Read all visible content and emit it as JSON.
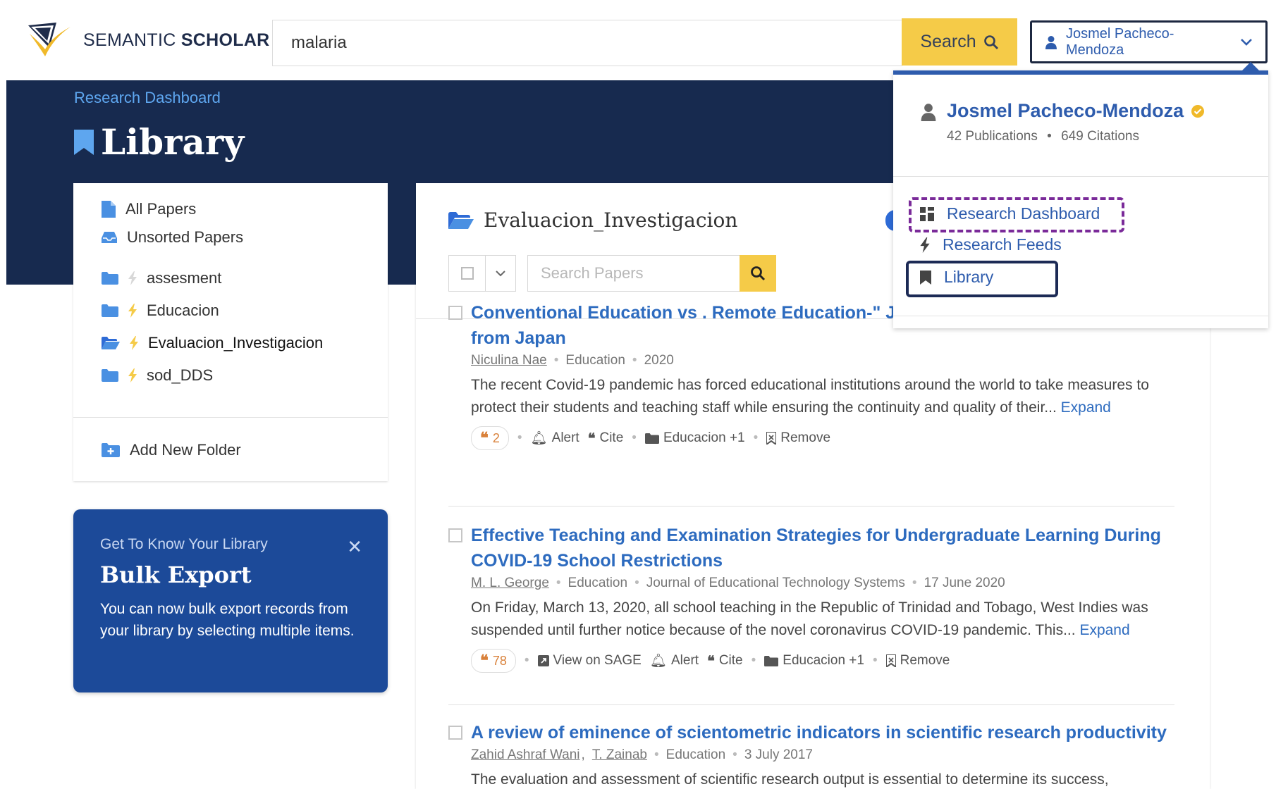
{
  "header": {
    "logo_text_light": "SEMANTIC",
    "logo_text_bold": "SCHOLAR",
    "search_value": "malaria",
    "search_button": "Search",
    "user_button": "Josmel Pacheco-Mendoza"
  },
  "hero": {
    "breadcrumb": "Research Dashboard",
    "title": "Library"
  },
  "sidebar": {
    "items": [
      {
        "label": "All Papers",
        "icon": "document-icon"
      },
      {
        "label": "Unsorted Papers",
        "icon": "inbox-icon"
      }
    ],
    "folders": [
      {
        "label": "assesment",
        "feed": false
      },
      {
        "label": "Educacion",
        "feed": true
      },
      {
        "label": "Evaluacion_Investigacion",
        "feed": true,
        "active": true
      },
      {
        "label": "sod_DDS",
        "feed": true
      }
    ],
    "add_folder": "Add New Folder"
  },
  "promo": {
    "kicker": "Get To Know Your Library",
    "title": "Bulk Export",
    "text": "You can now bulk export records from your library by selecting multiple items."
  },
  "main": {
    "folder_title": "Evaluacion_Investigacion",
    "search_placeholder": "Search Papers",
    "papers": [
      {
        "title": "Conventional Education vs . Remote Education-\" Just Put it Online ? \" A Report from Japan",
        "authors": [
          "Niculina Nae"
        ],
        "field": "Education",
        "date": "2020",
        "abstract": "The recent Covid-19 pandemic has forced educational institutions around the world to take measures to protect their students and teaching staff while ensuring the continuity and quality of their...",
        "expand": "Expand",
        "citations": "2",
        "alert": "Alert",
        "cite": "Cite",
        "folders": "Educacion +1",
        "remove": "Remove"
      },
      {
        "title": "Effective Teaching and Examination Strategies for Undergraduate Learning During COVID-19 School Restrictions",
        "authors": [
          "M. L. George"
        ],
        "field": "Education",
        "venue": "Journal of Educational Technology Systems",
        "date": "17 June 2020",
        "abstract": "On Friday, March 13, 2020, all school teaching in the Republic of Trinidad and Tobago, West Indies was suspended until further notice because of the novel coronavirus COVID-19 pandemic. This...",
        "expand": "Expand",
        "citations": "78",
        "view": "View on SAGE",
        "alert": "Alert",
        "cite": "Cite",
        "folders": "Educacion +1",
        "remove": "Remove"
      },
      {
        "title": "A review of eminence of scientometric indicators in scientific research productivity",
        "authors": [
          "Zahid Ashraf Wani",
          "T. Zainab"
        ],
        "field": "Education",
        "date": "3 July 2017",
        "abstract": "The evaluation and assessment of scientific research output is essential to determine its success,"
      }
    ]
  },
  "dropdown": {
    "name": "Josmel Pacheco-Mendoza",
    "publications": "42 Publications",
    "citations": "649 Citations",
    "items": [
      "Research Dashboard",
      "Research Feeds",
      "Library"
    ]
  },
  "colors": {
    "navy": "#172a4f",
    "accent_yellow": "#f5cb48",
    "link_blue": "#2d6bbf",
    "promo_blue": "#1c4a99",
    "highlight_purple": "#7a2a99"
  }
}
